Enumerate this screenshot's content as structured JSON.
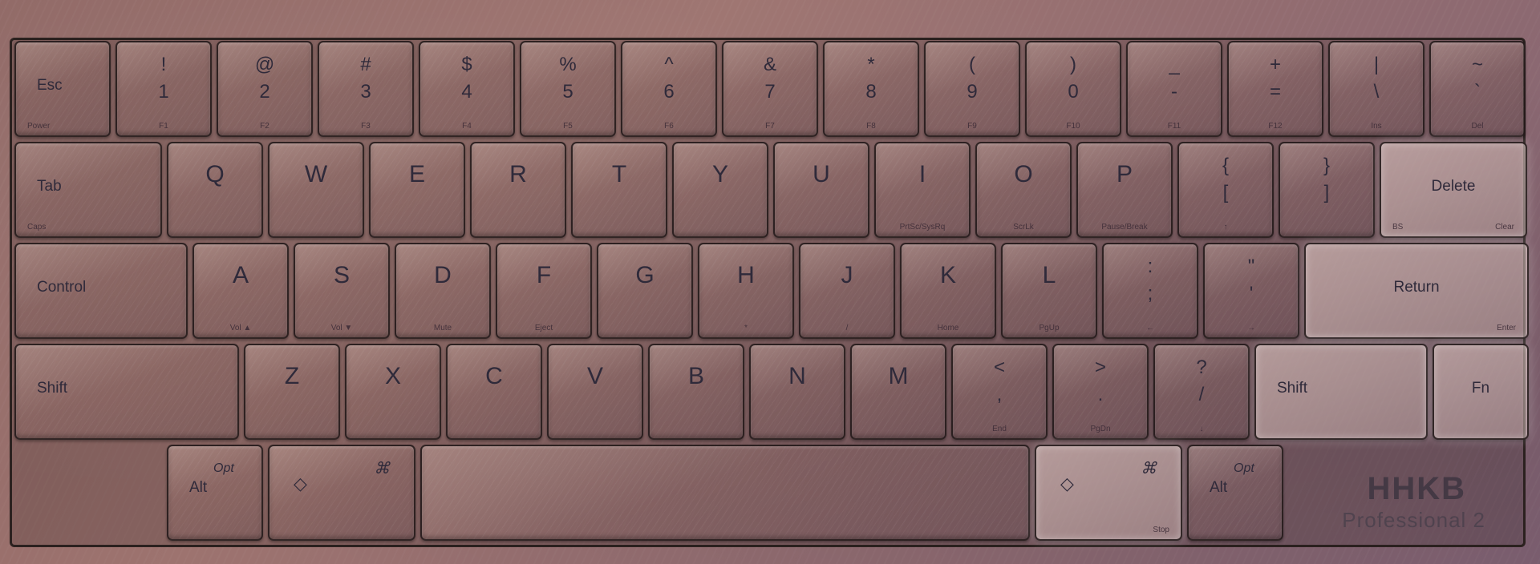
{
  "rows": [
    [
      {
        "name": "key-esc",
        "w": 120,
        "h": 120,
        "label": "Esc",
        "sub": "Power",
        "layout": "wide"
      },
      {
        "name": "key-1",
        "w": 120,
        "h": 120,
        "top": "!",
        "bottom": "1",
        "fn": "F1"
      },
      {
        "name": "key-2",
        "w": 120,
        "h": 120,
        "top": "@",
        "bottom": "2",
        "fn": "F2"
      },
      {
        "name": "key-3",
        "w": 120,
        "h": 120,
        "top": "#",
        "bottom": "3",
        "fn": "F3"
      },
      {
        "name": "key-4",
        "w": 120,
        "h": 120,
        "top": "$",
        "bottom": "4",
        "fn": "F4"
      },
      {
        "name": "key-5",
        "w": 120,
        "h": 120,
        "top": "%",
        "bottom": "5",
        "fn": "F5"
      },
      {
        "name": "key-6",
        "w": 120,
        "h": 120,
        "top": "^",
        "bottom": "6",
        "fn": "F6"
      },
      {
        "name": "key-7",
        "w": 120,
        "h": 120,
        "top": "&",
        "bottom": "7",
        "fn": "F7"
      },
      {
        "name": "key-8",
        "w": 120,
        "h": 120,
        "top": "*",
        "bottom": "8",
        "fn": "F8"
      },
      {
        "name": "key-9",
        "w": 120,
        "h": 120,
        "top": "(",
        "bottom": "9",
        "fn": "F9"
      },
      {
        "name": "key-0",
        "w": 120,
        "h": 120,
        "top": ")",
        "bottom": "0",
        "fn": "F10"
      },
      {
        "name": "key-minus",
        "w": 120,
        "h": 120,
        "top": "_",
        "bottom": "-",
        "fn": "F11"
      },
      {
        "name": "key-equal",
        "w": 120,
        "h": 120,
        "top": "+",
        "bottom": "=",
        "fn": "F12"
      },
      {
        "name": "key-backslash",
        "w": 120,
        "h": 120,
        "top": "|",
        "bottom": "\\",
        "fn": "Ins"
      },
      {
        "name": "key-backtick",
        "w": 120,
        "h": 120,
        "top": "~",
        "bottom": "`",
        "fn": "Del"
      }
    ],
    [
      {
        "name": "key-tab",
        "w": 184,
        "h": 120,
        "label": "Tab",
        "sub": "Caps",
        "layout": "wide"
      },
      {
        "name": "key-q",
        "w": 120,
        "h": 120,
        "cap": "Q"
      },
      {
        "name": "key-w",
        "w": 120,
        "h": 120,
        "cap": "W"
      },
      {
        "name": "key-e",
        "w": 120,
        "h": 120,
        "cap": "E"
      },
      {
        "name": "key-r",
        "w": 120,
        "h": 120,
        "cap": "R"
      },
      {
        "name": "key-t",
        "w": 120,
        "h": 120,
        "cap": "T"
      },
      {
        "name": "key-y",
        "w": 120,
        "h": 120,
        "cap": "Y"
      },
      {
        "name": "key-u",
        "w": 120,
        "h": 120,
        "cap": "U"
      },
      {
        "name": "key-i",
        "w": 120,
        "h": 120,
        "cap": "I",
        "fn": "PrtSc/SysRq"
      },
      {
        "name": "key-o",
        "w": 120,
        "h": 120,
        "cap": "O",
        "fn": "ScrLk"
      },
      {
        "name": "key-p",
        "w": 120,
        "h": 120,
        "cap": "P",
        "fn": "Pause/Break"
      },
      {
        "name": "key-lbracket",
        "w": 120,
        "h": 120,
        "top": "{",
        "bottom": "[",
        "fn": "↑"
      },
      {
        "name": "key-rbracket",
        "w": 120,
        "h": 120,
        "top": "}",
        "bottom": "]"
      },
      {
        "name": "key-delete",
        "w": 184,
        "h": 120,
        "label": "Delete",
        "sub": "BS",
        "sub2": "Clear",
        "layout": "wide-center",
        "light": true
      }
    ],
    [
      {
        "name": "key-control",
        "w": 216,
        "h": 120,
        "label": "Control",
        "layout": "wide"
      },
      {
        "name": "key-a",
        "w": 120,
        "h": 120,
        "cap": "A",
        "fn": "Vol ▲"
      },
      {
        "name": "key-s",
        "w": 120,
        "h": 120,
        "cap": "S",
        "fn": "Vol ▼"
      },
      {
        "name": "key-d",
        "w": 120,
        "h": 120,
        "cap": "D",
        "fn": "Mute"
      },
      {
        "name": "key-f",
        "w": 120,
        "h": 120,
        "cap": "F",
        "fn": "Eject"
      },
      {
        "name": "key-g",
        "w": 120,
        "h": 120,
        "cap": "G"
      },
      {
        "name": "key-h",
        "w": 120,
        "h": 120,
        "cap": "H",
        "fn": "*"
      },
      {
        "name": "key-j",
        "w": 120,
        "h": 120,
        "cap": "J",
        "fn": "/"
      },
      {
        "name": "key-k",
        "w": 120,
        "h": 120,
        "cap": "K",
        "fn": "Home"
      },
      {
        "name": "key-l",
        "w": 120,
        "h": 120,
        "cap": "L",
        "fn": "PgUp"
      },
      {
        "name": "key-semicolon",
        "w": 120,
        "h": 120,
        "top": ":",
        "bottom": ";",
        "fn": "←"
      },
      {
        "name": "key-quote",
        "w": 120,
        "h": 120,
        "top": "\"",
        "bottom": "'",
        "fn": "→"
      },
      {
        "name": "key-return",
        "w": 280,
        "h": 120,
        "label": "Return",
        "sub": "Enter",
        "layout": "wide-center",
        "light": true
      }
    ],
    [
      {
        "name": "key-shift-left",
        "w": 280,
        "h": 120,
        "label": "Shift",
        "layout": "wide"
      },
      {
        "name": "key-z",
        "w": 120,
        "h": 120,
        "cap": "Z"
      },
      {
        "name": "key-x",
        "w": 120,
        "h": 120,
        "cap": "X"
      },
      {
        "name": "key-c",
        "w": 120,
        "h": 120,
        "cap": "C"
      },
      {
        "name": "key-v",
        "w": 120,
        "h": 120,
        "cap": "V"
      },
      {
        "name": "key-b",
        "w": 120,
        "h": 120,
        "cap": "B"
      },
      {
        "name": "key-n",
        "w": 120,
        "h": 120,
        "cap": "N"
      },
      {
        "name": "key-m",
        "w": 120,
        "h": 120,
        "cap": "M"
      },
      {
        "name": "key-comma",
        "w": 120,
        "h": 120,
        "top": "<",
        "bottom": ",",
        "fn": "End"
      },
      {
        "name": "key-period",
        "w": 120,
        "h": 120,
        "top": ">",
        "bottom": ".",
        "fn": "PgDn"
      },
      {
        "name": "key-slash",
        "w": 120,
        "h": 120,
        "top": "?",
        "bottom": "/",
        "fn": "↓"
      },
      {
        "name": "key-shift-right",
        "w": 216,
        "h": 120,
        "label": "Shift",
        "layout": "wide",
        "light": true
      },
      {
        "name": "key-fn",
        "w": 120,
        "h": 120,
        "label": "Fn",
        "layout": "wide-center",
        "light": true
      }
    ],
    [
      {
        "name": "spacer",
        "w": 184,
        "h": 120,
        "spacer": true
      },
      {
        "name": "key-alt-left",
        "w": 120,
        "h": 120,
        "altTop": "Opt",
        "altBot": "Alt",
        "layout": "alt"
      },
      {
        "name": "key-cmd-left",
        "w": 184,
        "h": 120,
        "sym": "◇",
        "sym2": "⌘",
        "layout": "sym"
      },
      {
        "name": "key-space",
        "w": 760,
        "h": 120,
        "label": "",
        "layout": "wide"
      },
      {
        "name": "key-cmd-right",
        "w": 184,
        "h": 120,
        "sym": "◇",
        "sym2": "⌘",
        "sub": "Stop",
        "layout": "sym",
        "light": true
      },
      {
        "name": "key-alt-right",
        "w": 120,
        "h": 120,
        "altTop": "Opt",
        "altBot": "Alt",
        "layout": "alt"
      }
    ]
  ],
  "logo": {
    "mark": "HHKB",
    "sub": "Professional 2"
  }
}
